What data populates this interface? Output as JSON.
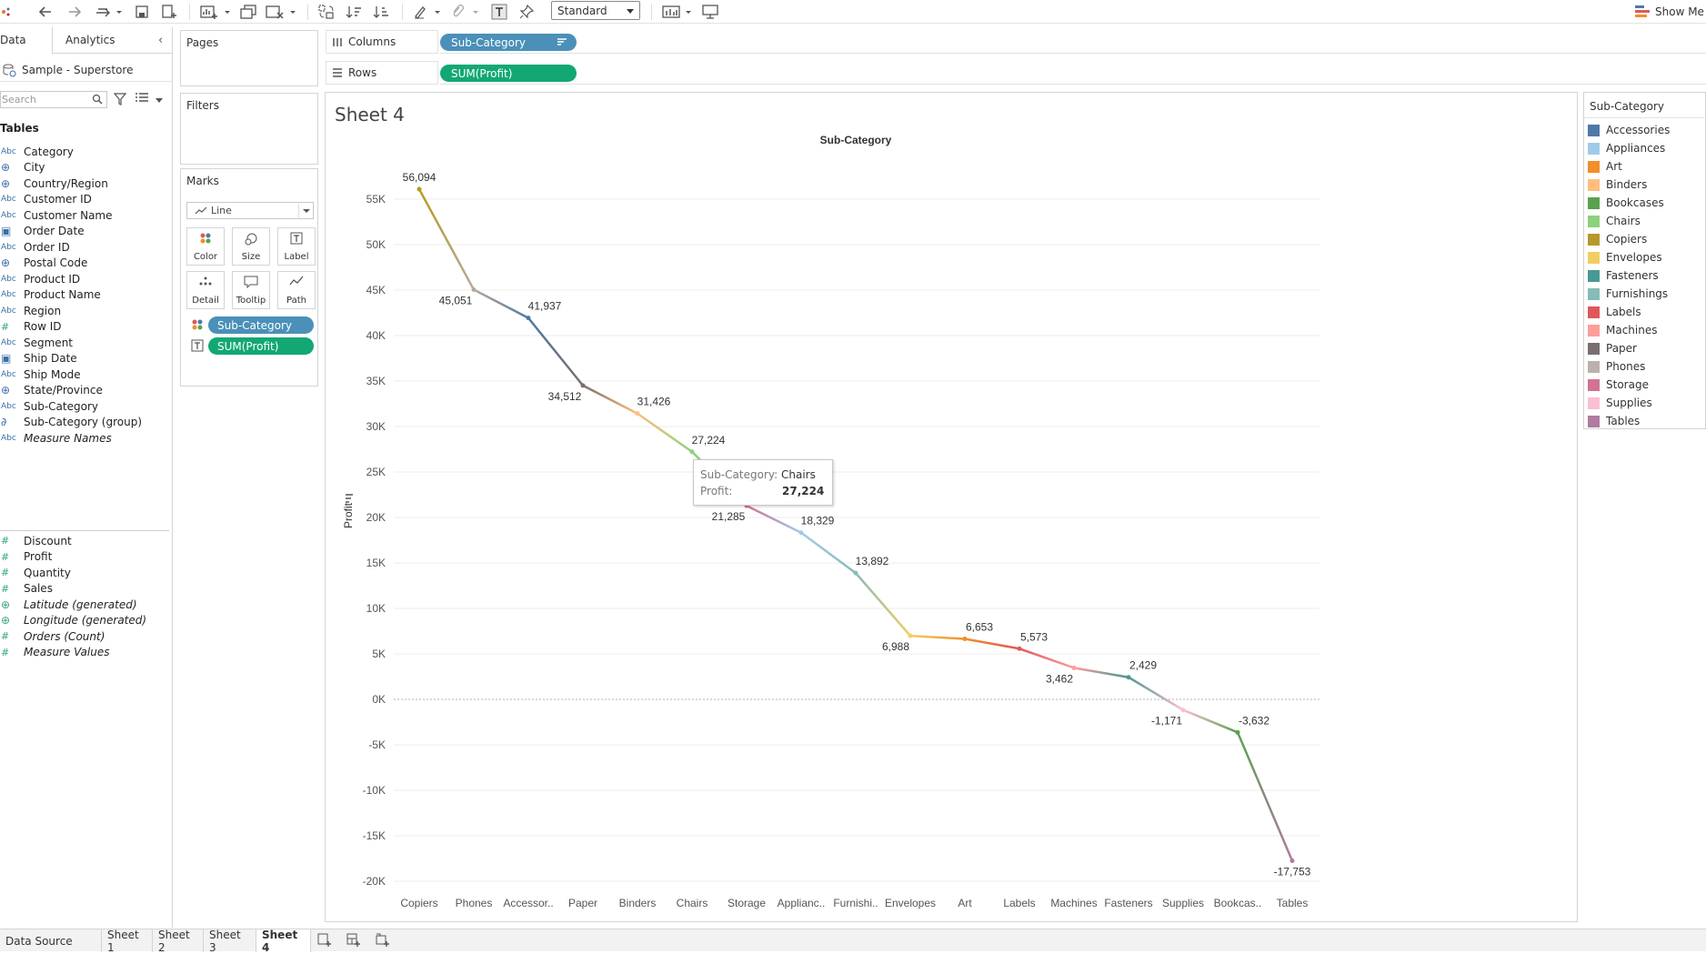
{
  "toolbar": {
    "view_mode": "Standard",
    "show_me": "Show Me"
  },
  "data_pane": {
    "tab_data": "Data",
    "tab_analytics": "Analytics",
    "datasource": "Sample - Superstore",
    "search_placeholder": "Search",
    "tables_label": "Tables",
    "dimensions": [
      {
        "type": "Abc",
        "name": "Category"
      },
      {
        "type": "geo",
        "name": "City"
      },
      {
        "type": "geo",
        "name": "Country/Region"
      },
      {
        "type": "Abc",
        "name": "Customer ID"
      },
      {
        "type": "Abc",
        "name": "Customer Name"
      },
      {
        "type": "date",
        "name": "Order Date"
      },
      {
        "type": "Abc",
        "name": "Order ID"
      },
      {
        "type": "geo",
        "name": "Postal Code"
      },
      {
        "type": "Abc",
        "name": "Product ID"
      },
      {
        "type": "Abc",
        "name": "Product Name"
      },
      {
        "type": "Abc",
        "name": "Region"
      },
      {
        "type": "#",
        "name": "Row ID"
      },
      {
        "type": "Abc",
        "name": "Segment"
      },
      {
        "type": "date",
        "name": "Ship Date"
      },
      {
        "type": "Abc",
        "name": "Ship Mode"
      },
      {
        "type": "geo",
        "name": "State/Province"
      },
      {
        "type": "Abc",
        "name": "Sub-Category"
      },
      {
        "type": "clip",
        "name": "Sub-Category (group)"
      },
      {
        "type": "Abc",
        "name": "Measure Names",
        "italic": true
      }
    ],
    "measures": [
      {
        "type": "#",
        "name": "Discount"
      },
      {
        "type": "#",
        "name": "Profit"
      },
      {
        "type": "#",
        "name": "Quantity"
      },
      {
        "type": "#",
        "name": "Sales"
      },
      {
        "type": "geo",
        "name": "Latitude (generated)",
        "italic": true
      },
      {
        "type": "geo",
        "name": "Longitude (generated)",
        "italic": true
      },
      {
        "type": "#",
        "name": "Orders (Count)",
        "italic": true
      },
      {
        "type": "#",
        "name": "Measure Values",
        "italic": true
      }
    ]
  },
  "cards": {
    "pages": "Pages",
    "filters": "Filters",
    "marks": "Marks",
    "mark_type": "Line",
    "buttons": [
      "Color",
      "Size",
      "Label",
      "Detail",
      "Tooltip",
      "Path"
    ],
    "pills": [
      {
        "label": "Sub-Category",
        "color": "#4a90b8"
      },
      {
        "label": "SUM(Profit)",
        "color": "#13a873"
      }
    ]
  },
  "shelves": {
    "columns_label": "Columns",
    "columns_pill": "Sub-Category",
    "columns_color": "#4a90b8",
    "rows_label": "Rows",
    "rows_pill": "SUM(Profit)",
    "rows_color": "#13a873"
  },
  "sheet_title": "Sheet 4",
  "chart_data": {
    "type": "line",
    "title": "Sub-Category",
    "xlabel": "",
    "ylabel": "Profit",
    "ylim": [
      -20000,
      55000
    ],
    "yticks": [
      "55K",
      "50K",
      "45K",
      "40K",
      "35K",
      "30K",
      "25K",
      "20K",
      "15K",
      "10K",
      "5K",
      "0K",
      "-5K",
      "-10K",
      "-15K",
      "-20K"
    ],
    "categories": [
      "Copiers",
      "Phones",
      "Accessor..",
      "Paper",
      "Binders",
      "Chairs",
      "Storage",
      "Applianc..",
      "Furnishi..",
      "Envelopes",
      "Art",
      "Labels",
      "Machines",
      "Fasteners",
      "Supplies",
      "Bookcas..",
      "Tables"
    ],
    "values": [
      56094,
      45051,
      41937,
      34512,
      31426,
      27224,
      21285,
      18329,
      13892,
      6988,
      6653,
      5573,
      3462,
      2429,
      -1171,
      -3632,
      -17753
    ],
    "data_labels": [
      "56,094",
      "45,051",
      "41,937",
      "34,512",
      "31,426",
      "27,224",
      "21,285",
      "18,329",
      "13,892",
      "6,988",
      "6,653",
      "5,573",
      "3,462",
      "2,429",
      "-1,171",
      "-3,632",
      "-17,753"
    ],
    "colors": [
      "#b79a20",
      "#b6aa9e",
      "#4e79a7",
      "#79706e",
      "#ffbe7d",
      "#8cd17d",
      "#d37295",
      "#a0cbe8",
      "#86bcb6",
      "#f1ce63",
      "#f28e2b",
      "#e15759",
      "#ff9d9a",
      "#499894",
      "#fabfd2",
      "#59a14f",
      "#b07aa1"
    ],
    "grid": true,
    "legend_position": "right"
  },
  "legend": {
    "title": "Sub-Category",
    "items": [
      {
        "name": "Accessories",
        "color": "#4e79a7"
      },
      {
        "name": "Appliances",
        "color": "#a0cbe8"
      },
      {
        "name": "Art",
        "color": "#f28e2b"
      },
      {
        "name": "Binders",
        "color": "#ffbe7d"
      },
      {
        "name": "Bookcases",
        "color": "#59a14f"
      },
      {
        "name": "Chairs",
        "color": "#8cd17d"
      },
      {
        "name": "Copiers",
        "color": "#b6992d"
      },
      {
        "name": "Envelopes",
        "color": "#f1ce63"
      },
      {
        "name": "Fasteners",
        "color": "#499894"
      },
      {
        "name": "Furnishings",
        "color": "#86bcb6"
      },
      {
        "name": "Labels",
        "color": "#e15759"
      },
      {
        "name": "Machines",
        "color": "#ff9d9a"
      },
      {
        "name": "Paper",
        "color": "#79706e"
      },
      {
        "name": "Phones",
        "color": "#bab0ac"
      },
      {
        "name": "Storage",
        "color": "#d37295"
      },
      {
        "name": "Supplies",
        "color": "#fabfd2"
      },
      {
        "name": "Tables",
        "color": "#b07aa1"
      }
    ]
  },
  "tooltip": {
    "key1": "Sub-Category:",
    "val1": "Chairs",
    "key2": "Profit:",
    "val2": "27,224"
  },
  "bottom_tabs": [
    "Data Source",
    "Sheet 1",
    "Sheet 2",
    "Sheet 3",
    "Sheet 4"
  ]
}
